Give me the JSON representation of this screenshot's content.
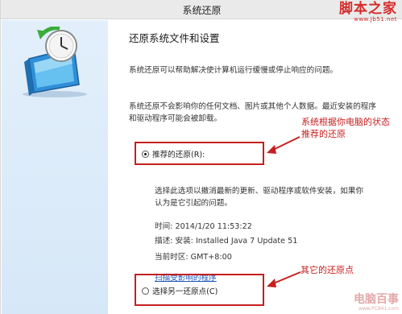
{
  "window": {
    "title": "系统还原"
  },
  "watermark_top": {
    "brand": "脚本之家",
    "url": "www.Jb51.net"
  },
  "watermark_bottom": {
    "brand": "电脑百事",
    "url": "www.PC841.com"
  },
  "main": {
    "heading": "还原系统文件和设置",
    "intro": "系统还原可以帮助解决使计算机运行缓慢或停止响应的问题。",
    "notice": "系统还原不会影响你的任何文档、图片或其他个人数据。最近安装的程序和驱动程序可能会被卸载。",
    "options": {
      "recommended_label": "推荐的还原(R):",
      "recommended_selected": true,
      "other_label": "选择另一还原点(C)",
      "other_selected": false
    },
    "recommended_desc": "选择此选项以撤消最新的更新、驱动程序或软件安装，如果你认为是它引起的问题。",
    "time": "时间: 2014/1/20 11:53:22",
    "description": "描述: 安装: Installed Java 7 Update 51",
    "timezone": "当前时区: GMT+8:00",
    "scan_link": "扫描受影响的程序"
  },
  "annotations": {
    "first": "系统根据你电脑的状态\n推荐的还原",
    "second": "其它的还原点",
    "color": "#c61f1f"
  },
  "icons": {
    "app": "system-restore-icon"
  }
}
